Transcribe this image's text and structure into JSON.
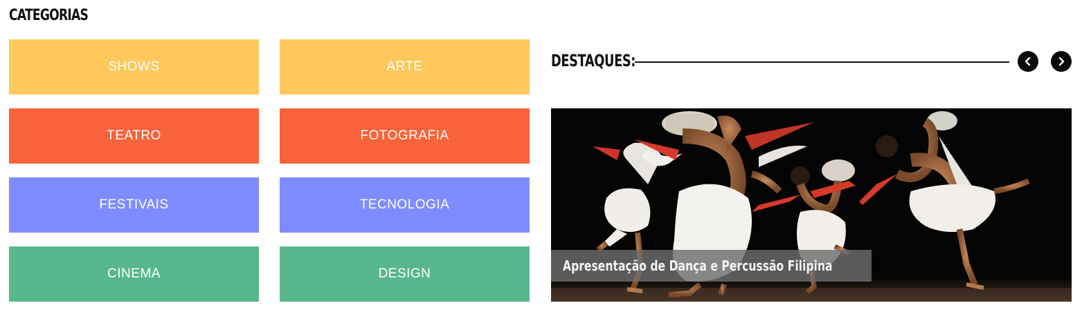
{
  "categories": {
    "title": "CATEGORIAS",
    "items": [
      {
        "label": "SHOWS",
        "color": "#fec85b"
      },
      {
        "label": "ARTE",
        "color": "#fec85b"
      },
      {
        "label": "TEATRO",
        "color": "#f8633b"
      },
      {
        "label": "FOTOGRAFIA",
        "color": "#f8633b"
      },
      {
        "label": "FESTIVAIS",
        "color": "#7f8cff"
      },
      {
        "label": "TECNOLOGIA",
        "color": "#7f8cff"
      },
      {
        "label": "CINEMA",
        "color": "#58b78a"
      },
      {
        "label": "DESIGN",
        "color": "#58b78a"
      }
    ]
  },
  "featured": {
    "label": "DESTAQUES:",
    "prev_icon": "chevron-left-icon",
    "next_icon": "chevron-right-icon",
    "slide": {
      "caption": "Apresentação de Dança e Percussão Filipina"
    }
  }
}
